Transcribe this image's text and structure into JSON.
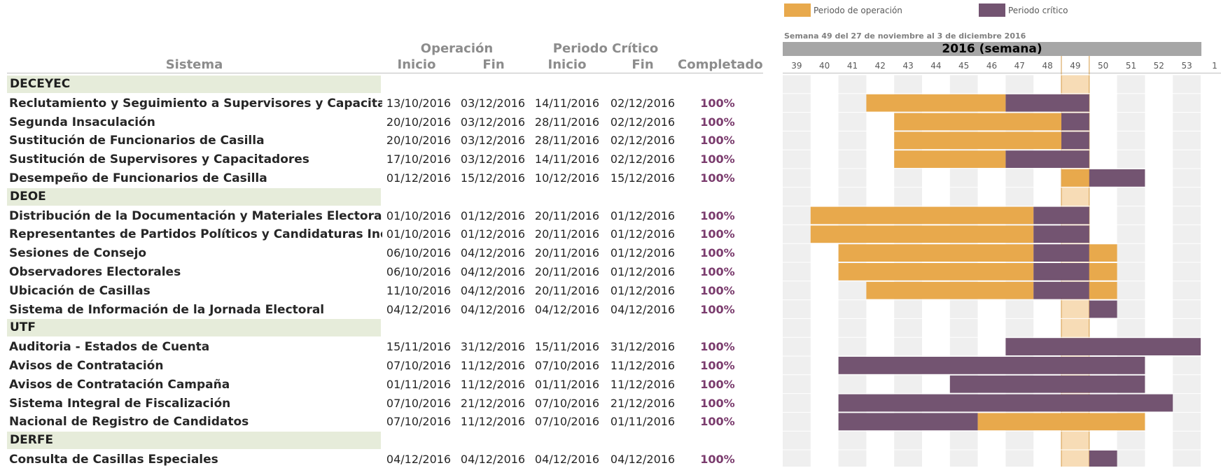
{
  "legend": {
    "operation_label": "Periodo de operación",
    "critical_label": "Periodo crítico",
    "operation_color": "#e8a94c",
    "critical_color": "#735471"
  },
  "header": {
    "operation_group": "Operación",
    "critical_group": "Periodo Crítico",
    "col_sistema": "Sistema",
    "col_inicio": "Inicio",
    "col_fin": "Fin",
    "col_inicio2": "Inicio",
    "col_fin2": "Fin",
    "col_completado": "Completado",
    "week_caption": "Semana 49 del 27 de noviembre al 3 de diciembre 2016",
    "year_label": "2016 (semana)"
  },
  "colors": {
    "section_bg": "#e6ecda",
    "grid_stripe": "#efefef",
    "current_week": "#f7dcb6",
    "current_week_border": "#d39a44",
    "percent_text": "#7a3b6d"
  },
  "chart_data": {
    "type": "gantt",
    "x_axis_label": "2016 (semana)",
    "weeks": [
      "39",
      "40",
      "41",
      "42",
      "43",
      "44",
      "45",
      "46",
      "47",
      "48",
      "49",
      "50",
      "51",
      "52",
      "53",
      "1"
    ],
    "current_week": "49",
    "rows": [
      {
        "kind": "section",
        "name": "DECEYEC"
      },
      {
        "kind": "task",
        "name": "Reclutamiento y Seguimiento a Supervisores y Capacitadores",
        "op_start": "13/10/2016",
        "op_end": "03/12/2016",
        "crit_start": "14/11/2016",
        "crit_end": "02/12/2016",
        "completed": "100%",
        "bars": [
          {
            "type": "op",
            "from": 42,
            "to": 47
          },
          {
            "type": "crit",
            "from": 47,
            "to": 50
          }
        ]
      },
      {
        "kind": "task",
        "name": "Segunda Insaculación",
        "op_start": "20/10/2016",
        "op_end": "03/12/2016",
        "crit_start": "28/11/2016",
        "crit_end": "02/12/2016",
        "completed": "100%",
        "bars": [
          {
            "type": "op",
            "from": 43,
            "to": 49
          },
          {
            "type": "crit",
            "from": 49,
            "to": 50
          }
        ]
      },
      {
        "kind": "task",
        "name": "Sustitución de Funcionarios de Casilla",
        "op_start": "20/10/2016",
        "op_end": "03/12/2016",
        "crit_start": "28/11/2016",
        "crit_end": "02/12/2016",
        "completed": "100%",
        "bars": [
          {
            "type": "op",
            "from": 43,
            "to": 49
          },
          {
            "type": "crit",
            "from": 49,
            "to": 50
          }
        ]
      },
      {
        "kind": "task",
        "name": "Sustitución de Supervisores y Capacitadores",
        "op_start": "17/10/2016",
        "op_end": "03/12/2016",
        "crit_start": "14/11/2016",
        "crit_end": "02/12/2016",
        "completed": "100%",
        "bars": [
          {
            "type": "op",
            "from": 43,
            "to": 47
          },
          {
            "type": "crit",
            "from": 47,
            "to": 50
          }
        ]
      },
      {
        "kind": "task",
        "name": "Desempeño de Funcionarios de Casilla",
        "op_start": "01/12/2016",
        "op_end": "15/12/2016",
        "crit_start": "10/12/2016",
        "crit_end": "15/12/2016",
        "completed": "100%",
        "bars": [
          {
            "type": "op",
            "from": 49,
            "to": 50
          },
          {
            "type": "crit",
            "from": 50,
            "to": 52
          }
        ]
      },
      {
        "kind": "section",
        "name": "DEOE"
      },
      {
        "kind": "task",
        "name": "Distribución de la Documentación y Materiales Electorales",
        "op_start": "01/10/2016",
        "op_end": "01/12/2016",
        "crit_start": "20/11/2016",
        "crit_end": "01/12/2016",
        "completed": "100%",
        "bars": [
          {
            "type": "op",
            "from": 40,
            "to": 48
          },
          {
            "type": "crit",
            "from": 48,
            "to": 50
          }
        ]
      },
      {
        "kind": "task",
        "name": "Representantes de Partidos Políticos y Candidaturas Independientes",
        "op_start": "01/10/2016",
        "op_end": "01/12/2016",
        "crit_start": "20/11/2016",
        "crit_end": "01/12/2016",
        "completed": "100%",
        "bars": [
          {
            "type": "op",
            "from": 40,
            "to": 48
          },
          {
            "type": "crit",
            "from": 48,
            "to": 50
          }
        ]
      },
      {
        "kind": "task",
        "name": "Sesiones de Consejo",
        "op_start": "06/10/2016",
        "op_end": "04/12/2016",
        "crit_start": "20/11/2016",
        "crit_end": "01/12/2016",
        "completed": "100%",
        "bars": [
          {
            "type": "op",
            "from": 41,
            "to": 48
          },
          {
            "type": "crit",
            "from": 48,
            "to": 50
          },
          {
            "type": "op",
            "from": 50,
            "to": 51
          }
        ]
      },
      {
        "kind": "task",
        "name": "Observadores Electorales",
        "op_start": "06/10/2016",
        "op_end": "04/12/2016",
        "crit_start": "20/11/2016",
        "crit_end": "01/12/2016",
        "completed": "100%",
        "bars": [
          {
            "type": "op",
            "from": 41,
            "to": 48
          },
          {
            "type": "crit",
            "from": 48,
            "to": 50
          },
          {
            "type": "op",
            "from": 50,
            "to": 51
          }
        ]
      },
      {
        "kind": "task",
        "name": "Ubicación de Casillas",
        "op_start": "11/10/2016",
        "op_end": "04/12/2016",
        "crit_start": "20/11/2016",
        "crit_end": "01/12/2016",
        "completed": "100%",
        "bars": [
          {
            "type": "op",
            "from": 42,
            "to": 48
          },
          {
            "type": "crit",
            "from": 48,
            "to": 50
          },
          {
            "type": "op",
            "from": 50,
            "to": 51
          }
        ]
      },
      {
        "kind": "task",
        "name": "Sistema de Información de la Jornada Electoral",
        "op_start": "04/12/2016",
        "op_end": "04/12/2016",
        "crit_start": "04/12/2016",
        "crit_end": "04/12/2016",
        "completed": "100%",
        "bars": [
          {
            "type": "crit",
            "from": 50,
            "to": 51
          }
        ]
      },
      {
        "kind": "section",
        "name": "UTF"
      },
      {
        "kind": "task",
        "name": "Auditoria - Estados de Cuenta",
        "op_start": "15/11/2016",
        "op_end": "31/12/2016",
        "crit_start": "15/11/2016",
        "crit_end": "31/12/2016",
        "completed": "100%",
        "bars": [
          {
            "type": "crit",
            "from": 47,
            "to": 54
          }
        ]
      },
      {
        "kind": "task",
        "name": "Avisos de Contratación",
        "op_start": "07/10/2016",
        "op_end": "11/12/2016",
        "crit_start": "07/10/2016",
        "crit_end": "11/12/2016",
        "completed": "100%",
        "bars": [
          {
            "type": "crit",
            "from": 41,
            "to": 52
          }
        ]
      },
      {
        "kind": "task",
        "name": "Avisos de Contratación Campaña",
        "op_start": "01/11/2016",
        "op_end": "11/12/2016",
        "crit_start": "01/11/2016",
        "crit_end": "11/12/2016",
        "completed": "100%",
        "bars": [
          {
            "type": "crit",
            "from": 45,
            "to": 52
          }
        ]
      },
      {
        "kind": "task",
        "name": "Sistema Integral de Fiscalización",
        "op_start": "07/10/2016",
        "op_end": "21/12/2016",
        "crit_start": "07/10/2016",
        "crit_end": "21/12/2016",
        "completed": "100%",
        "bars": [
          {
            "type": "crit",
            "from": 41,
            "to": 53
          }
        ]
      },
      {
        "kind": "task",
        "name": "Nacional de Registro de Candidatos",
        "op_start": "07/10/2016",
        "op_end": "11/12/2016",
        "crit_start": "07/10/2016",
        "crit_end": "01/11/2016",
        "completed": "100%",
        "bars": [
          {
            "type": "crit",
            "from": 41,
            "to": 46
          },
          {
            "type": "op",
            "from": 46,
            "to": 52
          }
        ]
      },
      {
        "kind": "section",
        "name": "DERFE"
      },
      {
        "kind": "task",
        "name": "Consulta de Casillas Especiales",
        "op_start": "04/12/2016",
        "op_end": "04/12/2016",
        "crit_start": "04/12/2016",
        "crit_end": "04/12/2016",
        "completed": "100%",
        "bars": [
          {
            "type": "crit",
            "from": 50,
            "to": 51
          }
        ]
      }
    ]
  }
}
